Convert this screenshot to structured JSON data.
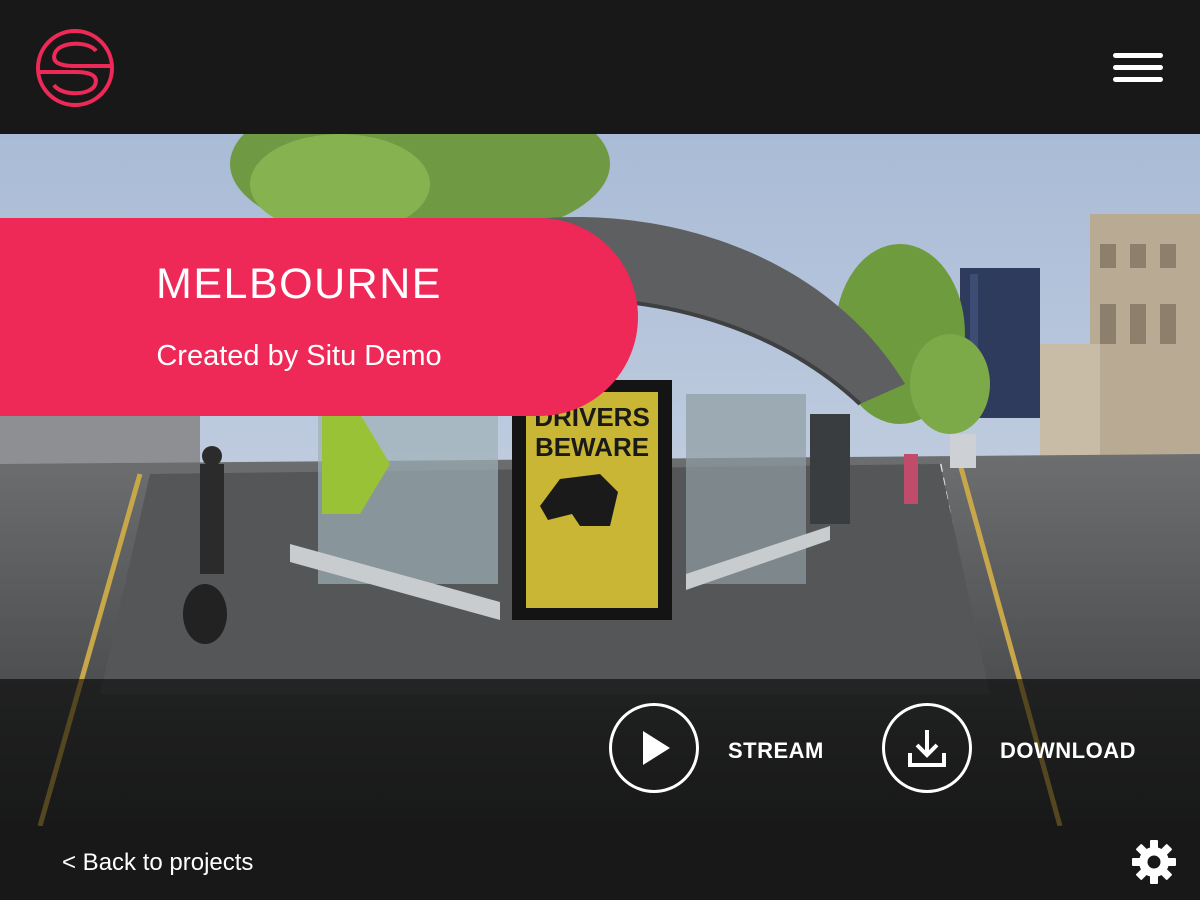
{
  "header": {
    "logo_icon": "situ-logo-icon",
    "menu_icon": "hamburger-menu-icon"
  },
  "project": {
    "title": "MELBOURNE",
    "subtitle": "Created by Situ Demo"
  },
  "actions": {
    "stream_label": "STREAM",
    "stream_icon": "play-icon",
    "download_label": "DOWNLOAD",
    "download_icon": "download-icon"
  },
  "scene": {
    "poster_title_line1": "DRIVERS",
    "poster_title_line2": "BEWARE"
  },
  "footer": {
    "back_label": "< Back to projects",
    "settings_icon": "gear-icon"
  },
  "colors": {
    "accent": "#ee2957",
    "bar": "#181818"
  }
}
